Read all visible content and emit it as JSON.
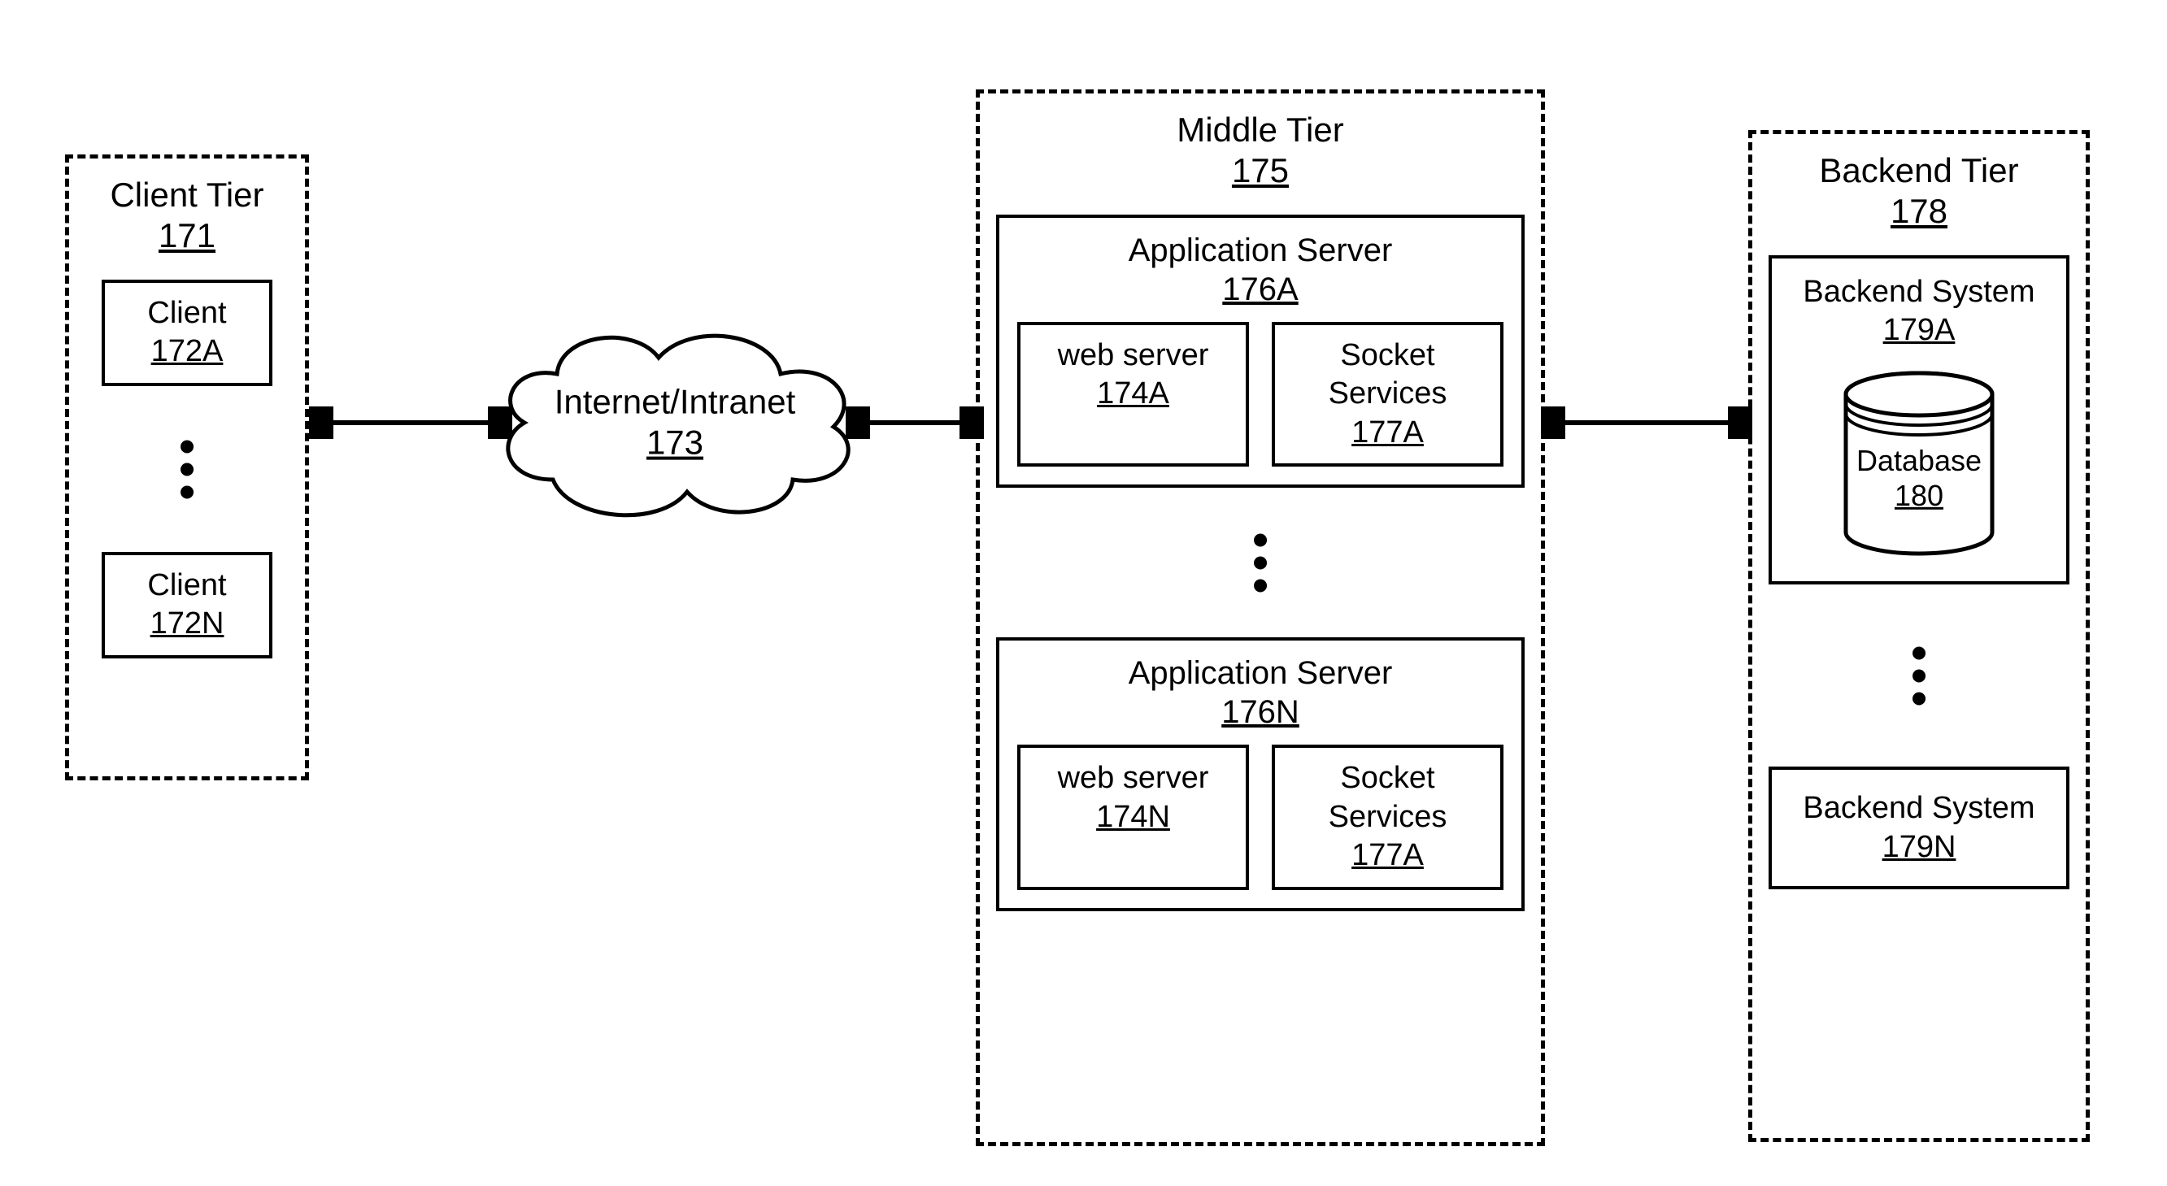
{
  "clientTier": {
    "title": "Client Tier",
    "ref": "171",
    "clientA": {
      "label": "Client",
      "ref": "172A"
    },
    "clientN": {
      "label": "Client",
      "ref": "172N"
    }
  },
  "cloud": {
    "label": "Internet/Intranet",
    "ref": "173"
  },
  "middleTier": {
    "title": "Middle Tier",
    "ref": "175",
    "appA": {
      "title": "Application Server",
      "ref": "176A",
      "web": {
        "label": "web server",
        "ref": "174A"
      },
      "socket": {
        "label": "Socket Services",
        "ref": "177A"
      }
    },
    "appN": {
      "title": "Application Server",
      "ref": "176N",
      "web": {
        "label": "web server",
        "ref": "174N"
      },
      "socket": {
        "label": "Socket Services",
        "ref": "177A"
      }
    }
  },
  "backendTier": {
    "title": "Backend Tier",
    "ref": "178",
    "sysA": {
      "label": "Backend System",
      "ref": "179A"
    },
    "db": {
      "label": "Database",
      "ref": "180"
    },
    "sysN": {
      "label": "Backend System",
      "ref": "179N"
    }
  }
}
